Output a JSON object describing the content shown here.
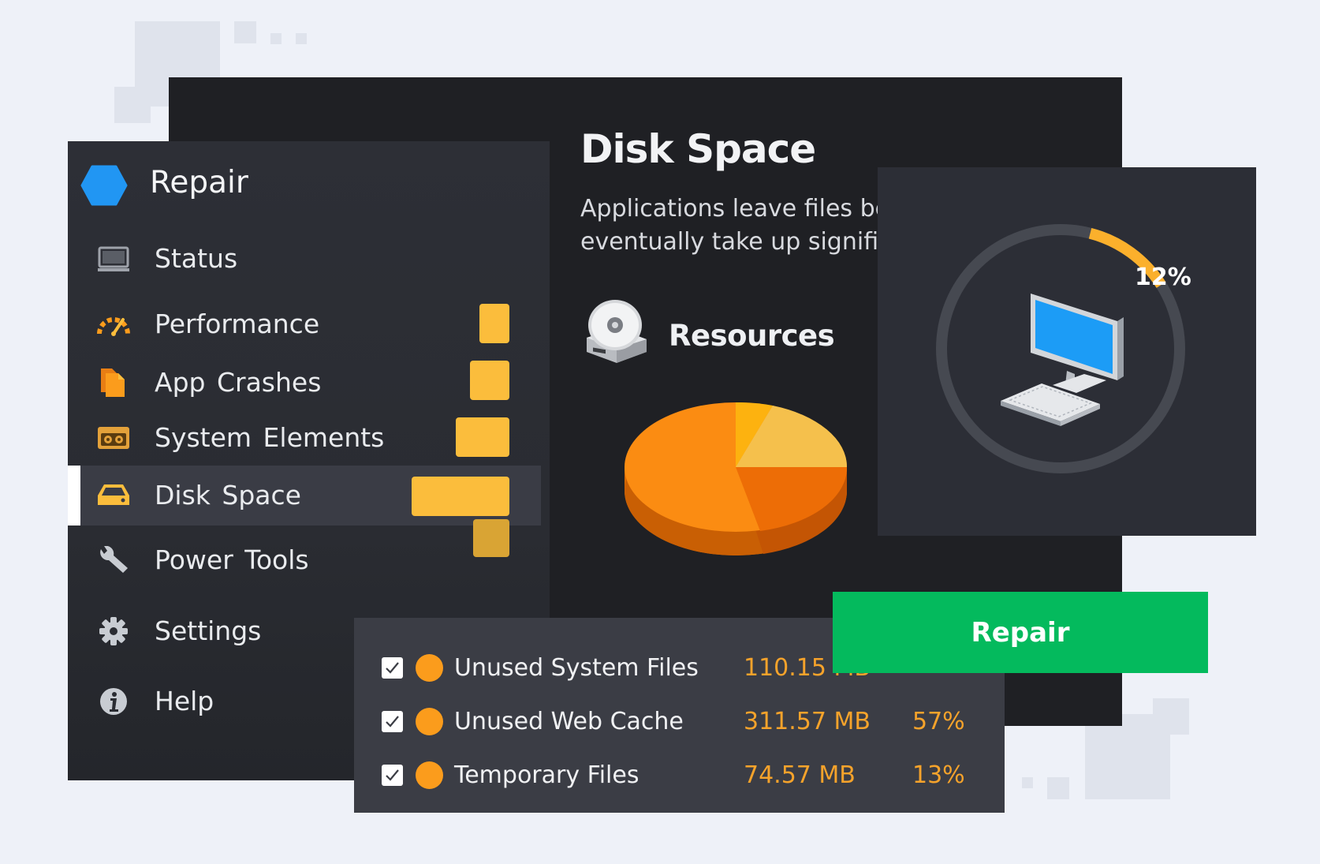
{
  "colors": {
    "accent_orange": "#fb9c1c",
    "bar_yellow": "#fbbd3c",
    "repair_green": "#04ba5d",
    "brand_blue": "#2196f3"
  },
  "sidebar": {
    "brand": {
      "label": "Repair",
      "icon": "hexagon-icon"
    },
    "items": [
      {
        "label": "Status",
        "icon": "monitor-icon",
        "bar_level": null
      },
      {
        "label": "Performance",
        "icon": "speedometer-icon",
        "bar_level": 0.3
      },
      {
        "label": "App  Crashes",
        "icon": "document-icon",
        "bar_level": 0.4
      },
      {
        "label": "System Elements",
        "icon": "cassette-icon",
        "bar_level": 0.55
      },
      {
        "label": "Disk Space",
        "icon": "hard-drive-icon",
        "bar_level": 1.0,
        "active": true
      },
      {
        "label": "Power Tools",
        "icon": "wrench-icon",
        "bar_level": 0.37
      },
      {
        "label": "Settings",
        "icon": "gear-icon",
        "bar_level": null
      },
      {
        "label": "Help",
        "icon": "info-icon",
        "bar_level": null
      }
    ]
  },
  "main": {
    "title": "Disk Space",
    "description_line1": "Applications leave files behind that",
    "description_line2": "eventually take up significant space",
    "resources_label": "Resources",
    "resources_icon": "disk-drive-icon"
  },
  "progress": {
    "percent_label": "12%",
    "value": 0.12,
    "icon": "desktop-computer-icon"
  },
  "files": [
    {
      "name": "Unused System Files",
      "size": "110.15 MB",
      "percent": "",
      "checked": true
    },
    {
      "name": "Unused Web Cache",
      "size": "311.57 MB",
      "percent": "57%",
      "checked": true
    },
    {
      "name": "Temporary Files",
      "size": "74.57 MB",
      "percent": "13%",
      "checked": true
    }
  ],
  "repair_button": {
    "label": "Repair"
  }
}
